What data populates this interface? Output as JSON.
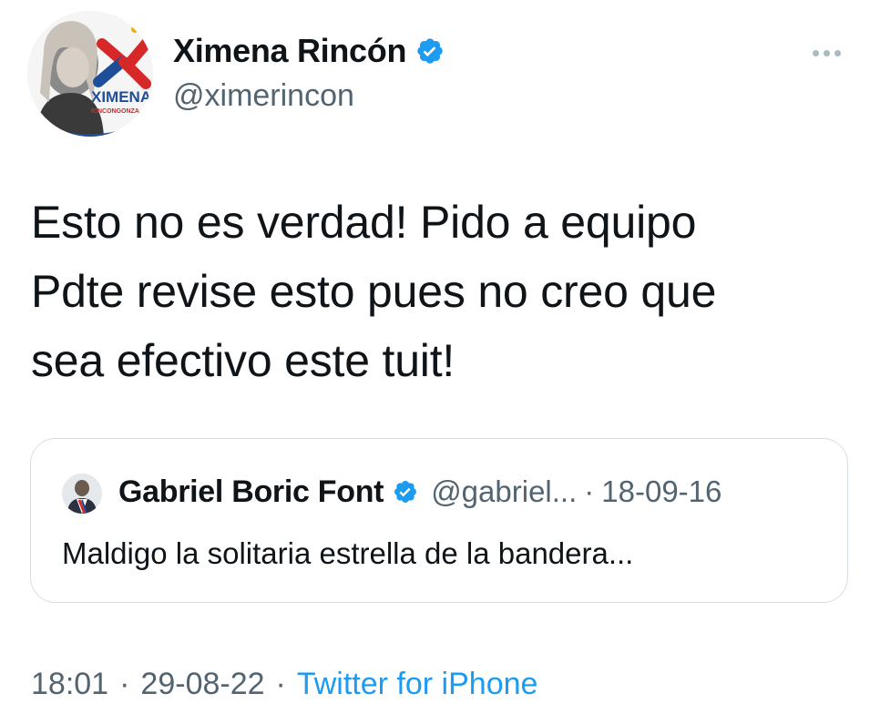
{
  "author": {
    "display_name": "Ximena Rincón",
    "handle": "@ximerincon",
    "avatar_text_1": "XIMENA",
    "avatar_text_2": "RINCONGONZA"
  },
  "more_icon": "more-horizontal-icon",
  "tweet": {
    "lines": [
      "Esto no es verdad! Pido a equipo",
      "Pdte revise esto pues no creo que",
      "sea efectivo este tuit!"
    ]
  },
  "quote": {
    "display_name": "Gabriel Boric Font",
    "handle": "@gabriel...",
    "separator": "·",
    "date": "18-09-16",
    "text": "Maldigo la solitaria estrella de la bandera..."
  },
  "meta": {
    "time": "18:01",
    "separator": "·",
    "date": "29-08-22",
    "source": "Twitter for iPhone"
  },
  "colors": {
    "verified": "#1d9bf0",
    "secondary_text": "#536471",
    "link": "#1d9bf0",
    "border": "#d6dde2"
  }
}
